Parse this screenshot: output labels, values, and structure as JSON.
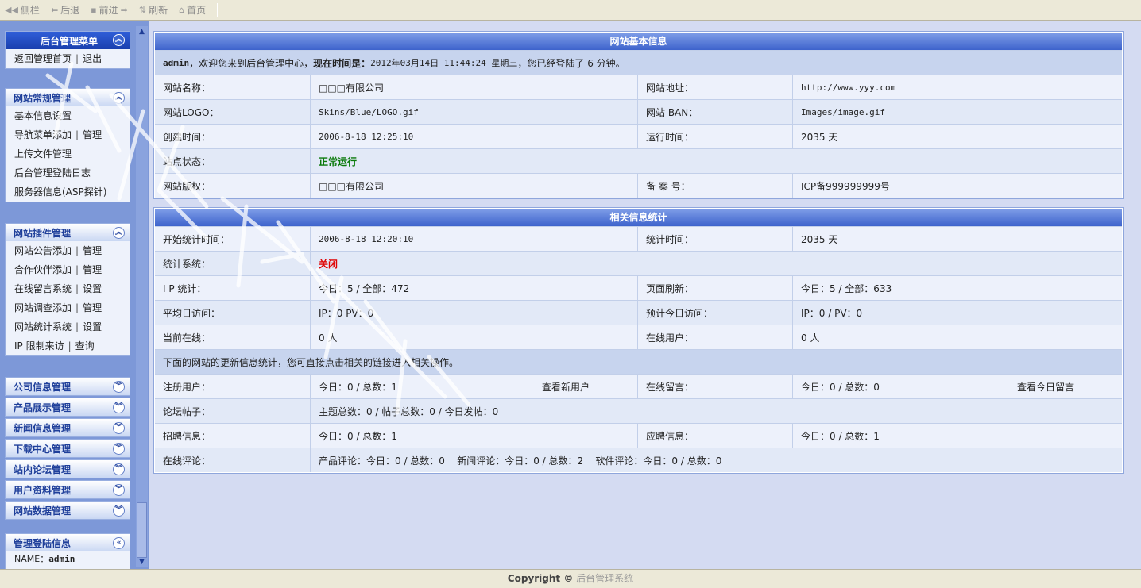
{
  "toolbar": {
    "sidebar": "侧栏",
    "back": "后退",
    "forward": "前进",
    "refresh": "刷新",
    "home": "首页"
  },
  "menu_header": {
    "title": "后台管理菜单",
    "items": [
      "返回管理首页",
      "退出"
    ]
  },
  "site_panel": {
    "title": "网站常规管理",
    "items": [
      "基本信息设置",
      "导航菜单添加",
      "管理",
      "上传文件管理",
      "后台管理登陆日志",
      "服务器信息(ASP探针)"
    ]
  },
  "plugin_panel": {
    "title": "网站插件管理",
    "items": [
      {
        "a": "网站公告添加",
        "b": "管理"
      },
      {
        "a": "合作伙伴添加",
        "b": "管理"
      },
      {
        "a": "在线留言系统",
        "b": "设置"
      },
      {
        "a": "网站调查添加",
        "b": "管理"
      },
      {
        "a": "网站统计系统",
        "b": "设置"
      },
      {
        "a": "IP  限制来访",
        "b": "查询"
      }
    ]
  },
  "collapsed_panels": [
    "公司信息管理",
    "产品展示管理",
    "新闻信息管理",
    "下载中心管理",
    "站内论坛管理",
    "用户资料管理",
    "网站数据管理"
  ],
  "login_panel": {
    "title": "管理登陆信息",
    "name_label": "NAME：",
    "name_value": "admin"
  },
  "basic_info": {
    "title": "网站基本信息",
    "welcome_user": "admin",
    "welcome_text": "，欢迎您来到后台管理中心，",
    "time_label": "现在时间是：",
    "time_value": "2012年03月14日 11:44:24 星期三",
    "login_text": "，您已经登陆了 6 分钟。",
    "site_name_label": "网站名称：",
    "site_name": "□□□有限公司",
    "site_url_label": "网站地址：",
    "site_url": "http://www.yyy.com",
    "logo_label": "网站LOGO：",
    "logo": "Skins/Blue/LOGO.gif",
    "ban_label": "网站 BAN：",
    "ban": "Images/image.gif",
    "created_label": "创建时间：",
    "created": "2006-8-18 12:25:10",
    "runtime_label": "运行时间：",
    "runtime": "2035 天",
    "status_label": "站点状态：",
    "status": "正常运行",
    "copyright_label": "网站版权：",
    "copyright": "□□□有限公司",
    "icp_label": "备 案 号：",
    "icp": "ICP备999999999号"
  },
  "stats": {
    "title": "相关信息统计",
    "start_label": "开始统计时间：",
    "start": "2006-8-18 12:20:10",
    "duration_label": "统计时间：",
    "duration": "2035 天",
    "system_label": "统计系统：",
    "system": "关闭",
    "ip_label": "I P 统计：",
    "ip": "今日：5 / 全部：472",
    "pv_label": "页面刷新：",
    "pv": "今日：5 / 全部：633",
    "avg_label": "平均日访问：",
    "avg": "IP：0  PV：0",
    "est_label": "预计今日访问：",
    "est": "IP：0 / PV：0",
    "online_label": "当前在线：",
    "online": "0 人",
    "users_online_label": "在线用户：",
    "users_online": "0 人",
    "note": "下面的网站的更新信息统计，您可直接点击相关的链接进入相关操作。",
    "reg_label": "注册用户：",
    "reg": "今日：0 / 总数：1",
    "reg_link": "查看新用户",
    "msg_label": "在线留言：",
    "msg": "今日：0 / 总数：0",
    "msg_link": "查看今日留言",
    "forum_label": "论坛帖子：",
    "forum": "主题总数：0 / 帖子总数：0 / 今日发帖：0",
    "job_label": "招聘信息：",
    "job": "今日：0 / 总数：1",
    "apply_label": "应聘信息：",
    "apply": "今日：0 / 总数：1",
    "comment_label": "在线评论：",
    "comment": "产品评论：今日：0 / 总数：0    新闻评论：今日：0 / 总数：2    软件评论：今日：0 / 总数：0"
  },
  "footer": {
    "brand": "Copyright ©",
    "text": "后台管理系统"
  }
}
